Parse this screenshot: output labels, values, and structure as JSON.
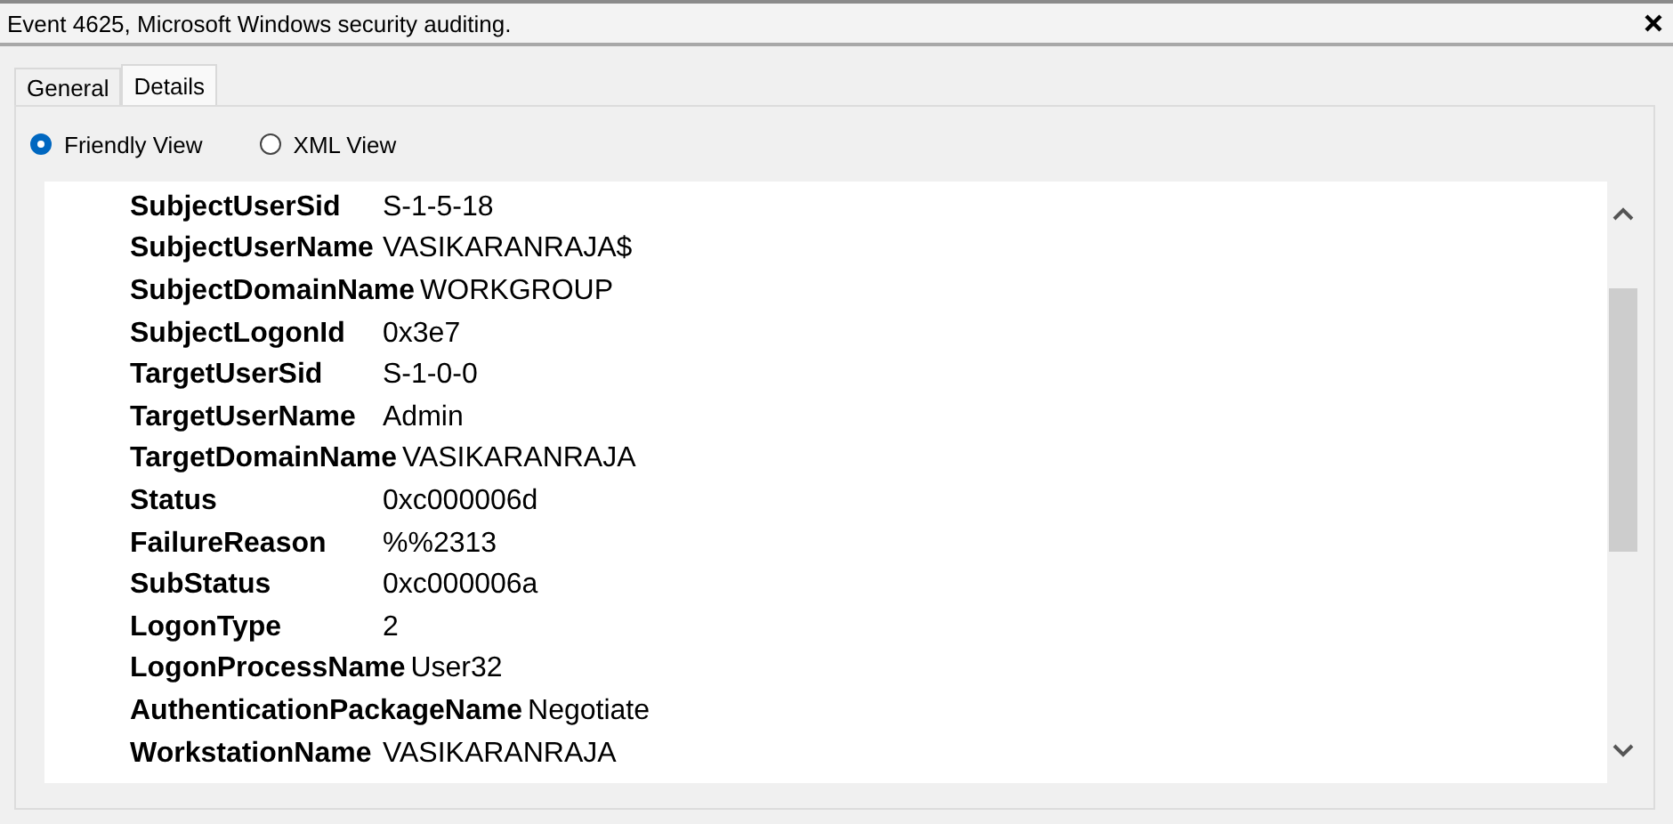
{
  "window": {
    "title": "Event 4625, Microsoft Windows security auditing."
  },
  "tabs": [
    {
      "label": "General",
      "selected": false
    },
    {
      "label": "Details",
      "selected": true
    }
  ],
  "view_options": [
    {
      "label": "Friendly View",
      "selected": true
    },
    {
      "label": "XML View",
      "selected": false
    }
  ],
  "fields": [
    {
      "name": "SubjectUserSid",
      "value": "S-1-5-18"
    },
    {
      "name": "SubjectUserName",
      "value": "VASIKARANRAJA$"
    },
    {
      "name": "SubjectDomainName",
      "value": "WORKGROUP"
    },
    {
      "name": "SubjectLogonId",
      "value": "0x3e7"
    },
    {
      "name": "TargetUserSid",
      "value": "S-1-0-0"
    },
    {
      "name": "TargetUserName",
      "value": "Admin"
    },
    {
      "name": "TargetDomainName",
      "value": "VASIKARANRAJA"
    },
    {
      "name": "Status",
      "value": "0xc000006d"
    },
    {
      "name": "FailureReason",
      "value": "%%2313"
    },
    {
      "name": "SubStatus",
      "value": "0xc000006a"
    },
    {
      "name": "LogonType",
      "value": "2"
    },
    {
      "name": "LogonProcessName",
      "value": "User32"
    },
    {
      "name": "AuthenticationPackageName",
      "value": "Negotiate"
    },
    {
      "name": "WorkstationName",
      "value": "VASIKARANRAJA"
    }
  ]
}
